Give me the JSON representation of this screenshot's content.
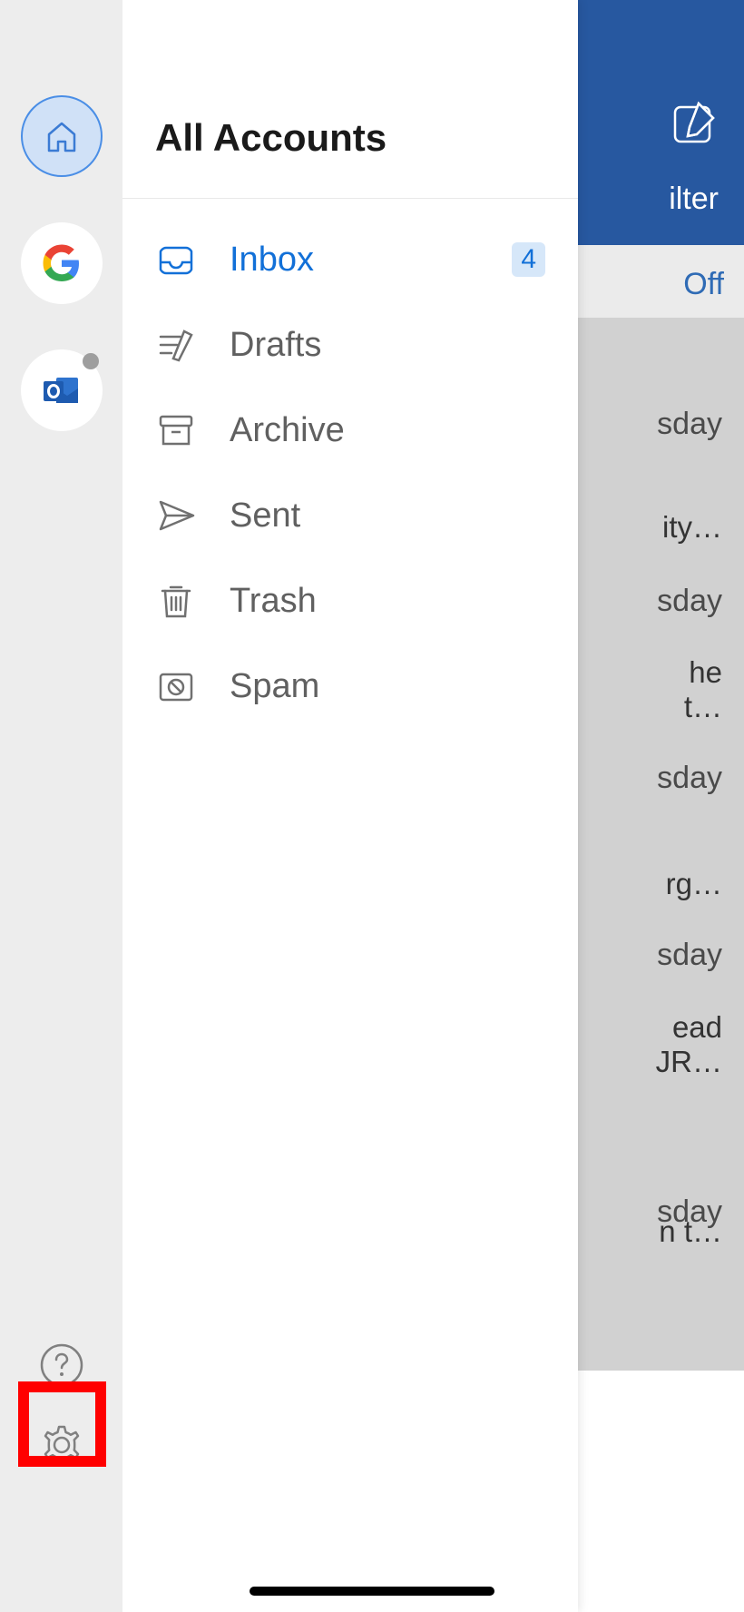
{
  "drawer": {
    "title": "All Accounts",
    "folders": [
      {
        "label": "Inbox",
        "badge": "4",
        "selected": true
      },
      {
        "label": "Drafts"
      },
      {
        "label": "Archive"
      },
      {
        "label": "Sent"
      },
      {
        "label": "Trash"
      },
      {
        "label": "Spam"
      }
    ]
  },
  "background": {
    "filter_text": "ilter",
    "off_text": "Off",
    "items": [
      {
        "day": "sday",
        "preview1": "ity…"
      },
      {
        "day": "sday",
        "preview1": "he",
        "preview2": "t…"
      },
      {
        "day": "sday",
        "preview1": "rg…"
      },
      {
        "day": "sday",
        "preview1": "ead",
        "preview2": "JR…"
      },
      {
        "day": "sday",
        "preview1": "n t…"
      }
    ]
  }
}
